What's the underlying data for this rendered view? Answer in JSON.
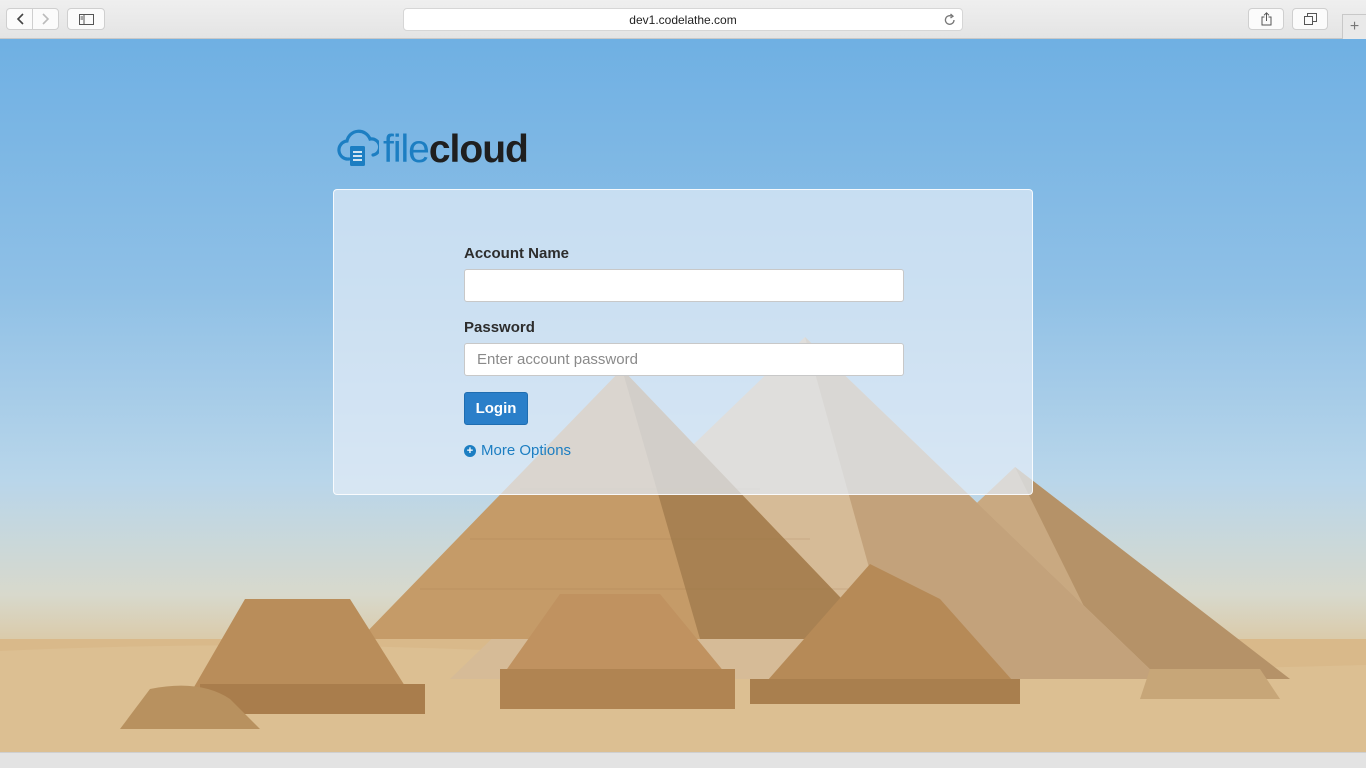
{
  "browser": {
    "url": "dev1.codelathe.com",
    "back_icon": "chevron-left-icon",
    "forward_icon": "chevron-right-icon",
    "sidebar_icon": "sidebar-icon",
    "share_icon": "share-icon",
    "tabs_icon": "tabs-icon",
    "reload_icon": "reload-icon",
    "new_tab_icon": "plus-icon"
  },
  "brand": {
    "word_file": "file",
    "word_cloud": "cloud",
    "color_primary": "#1c7ec2",
    "color_dark": "#1f1f1f"
  },
  "login": {
    "account_label": "Account Name",
    "account_value": "",
    "password_label": "Password",
    "password_placeholder": "Enter account password",
    "login_button": "Login",
    "more_options": "More Options",
    "button_color": "#2a7fc9"
  }
}
